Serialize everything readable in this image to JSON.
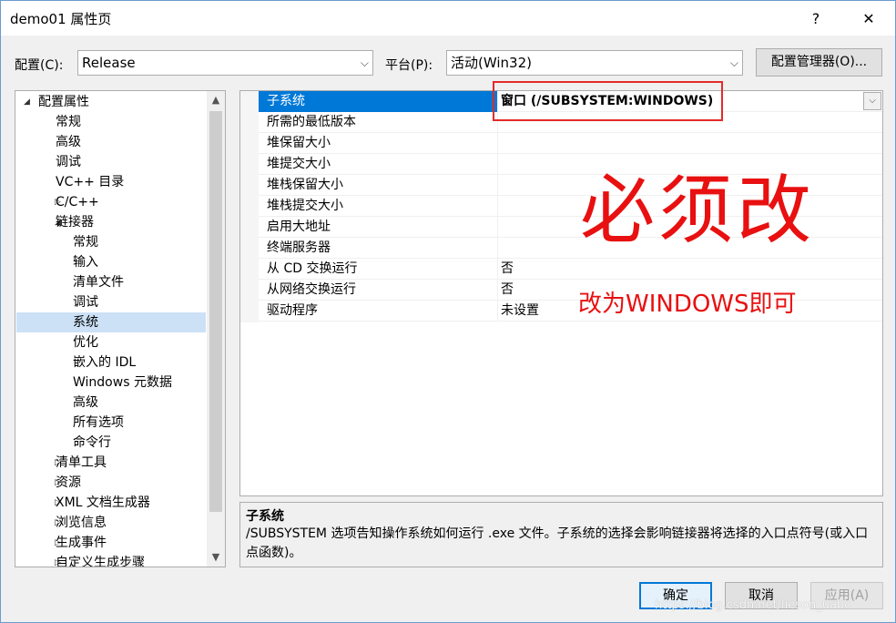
{
  "window": {
    "title": "demo01 属性页",
    "help": "?",
    "close": "✕"
  },
  "config": {
    "label": "配置(C):",
    "value": "Release"
  },
  "platform": {
    "label": "平台(P):",
    "value": "活动(Win32)"
  },
  "config_manager": "配置管理器(O)...",
  "tree": [
    {
      "label": "配置属性",
      "expander": "◢",
      "level": 0
    },
    {
      "label": "常规",
      "level": 1
    },
    {
      "label": "高级",
      "level": 1
    },
    {
      "label": "调试",
      "level": 1
    },
    {
      "label": "VC++ 目录",
      "level": 1
    },
    {
      "label": "C/C++",
      "expander": "▷",
      "level": 1
    },
    {
      "label": "链接器",
      "expander": "◢",
      "level": 1
    },
    {
      "label": "常规",
      "level": 2
    },
    {
      "label": "输入",
      "level": 2
    },
    {
      "label": "清单文件",
      "level": 2
    },
    {
      "label": "调试",
      "level": 2
    },
    {
      "label": "系统",
      "level": 2,
      "selected": true
    },
    {
      "label": "优化",
      "level": 2
    },
    {
      "label": "嵌入的 IDL",
      "level": 2
    },
    {
      "label": "Windows 元数据",
      "level": 2
    },
    {
      "label": "高级",
      "level": 2
    },
    {
      "label": "所有选项",
      "level": 2
    },
    {
      "label": "命令行",
      "level": 2
    },
    {
      "label": "清单工具",
      "expander": "▷",
      "level": 1
    },
    {
      "label": "资源",
      "expander": "▷",
      "level": 1
    },
    {
      "label": "XML 文档生成器",
      "expander": "▷",
      "level": 1
    },
    {
      "label": "浏览信息",
      "expander": "▷",
      "level": 1
    },
    {
      "label": "生成事件",
      "expander": "▷",
      "level": 1
    },
    {
      "label": "自定义生成步骤",
      "expander": "▷",
      "level": 1
    }
  ],
  "properties": [
    {
      "name": "子系统",
      "value": "窗口 (/SUBSYSTEM:WINDOWS)",
      "selected": true
    },
    {
      "name": "所需的最低版本",
      "value": ""
    },
    {
      "name": "堆保留大小",
      "value": ""
    },
    {
      "name": "堆提交大小",
      "value": ""
    },
    {
      "name": "堆栈保留大小",
      "value": ""
    },
    {
      "name": "堆栈提交大小",
      "value": ""
    },
    {
      "name": "启用大地址",
      "value": ""
    },
    {
      "name": "终端服务器",
      "value": ""
    },
    {
      "name": "从 CD 交换运行",
      "value": "否"
    },
    {
      "name": "从网络交换运行",
      "value": "否"
    },
    {
      "name": "驱动程序",
      "value": "未设置"
    }
  ],
  "annotations": {
    "big": "必须改",
    "small": "改为WINDOWS即可",
    "color": "#e81010"
  },
  "description": {
    "title": "子系统",
    "text": "/SUBSYSTEM 选项告知操作系统如何运行 .exe 文件。子系统的选择会影响链接器将选择的入口点符号(或入口点函数)。"
  },
  "buttons": {
    "ok": "确定",
    "cancel": "取消",
    "apply": "应用(A)"
  },
  "watermark": "https://blog.csdn.net/lieson_uabc"
}
